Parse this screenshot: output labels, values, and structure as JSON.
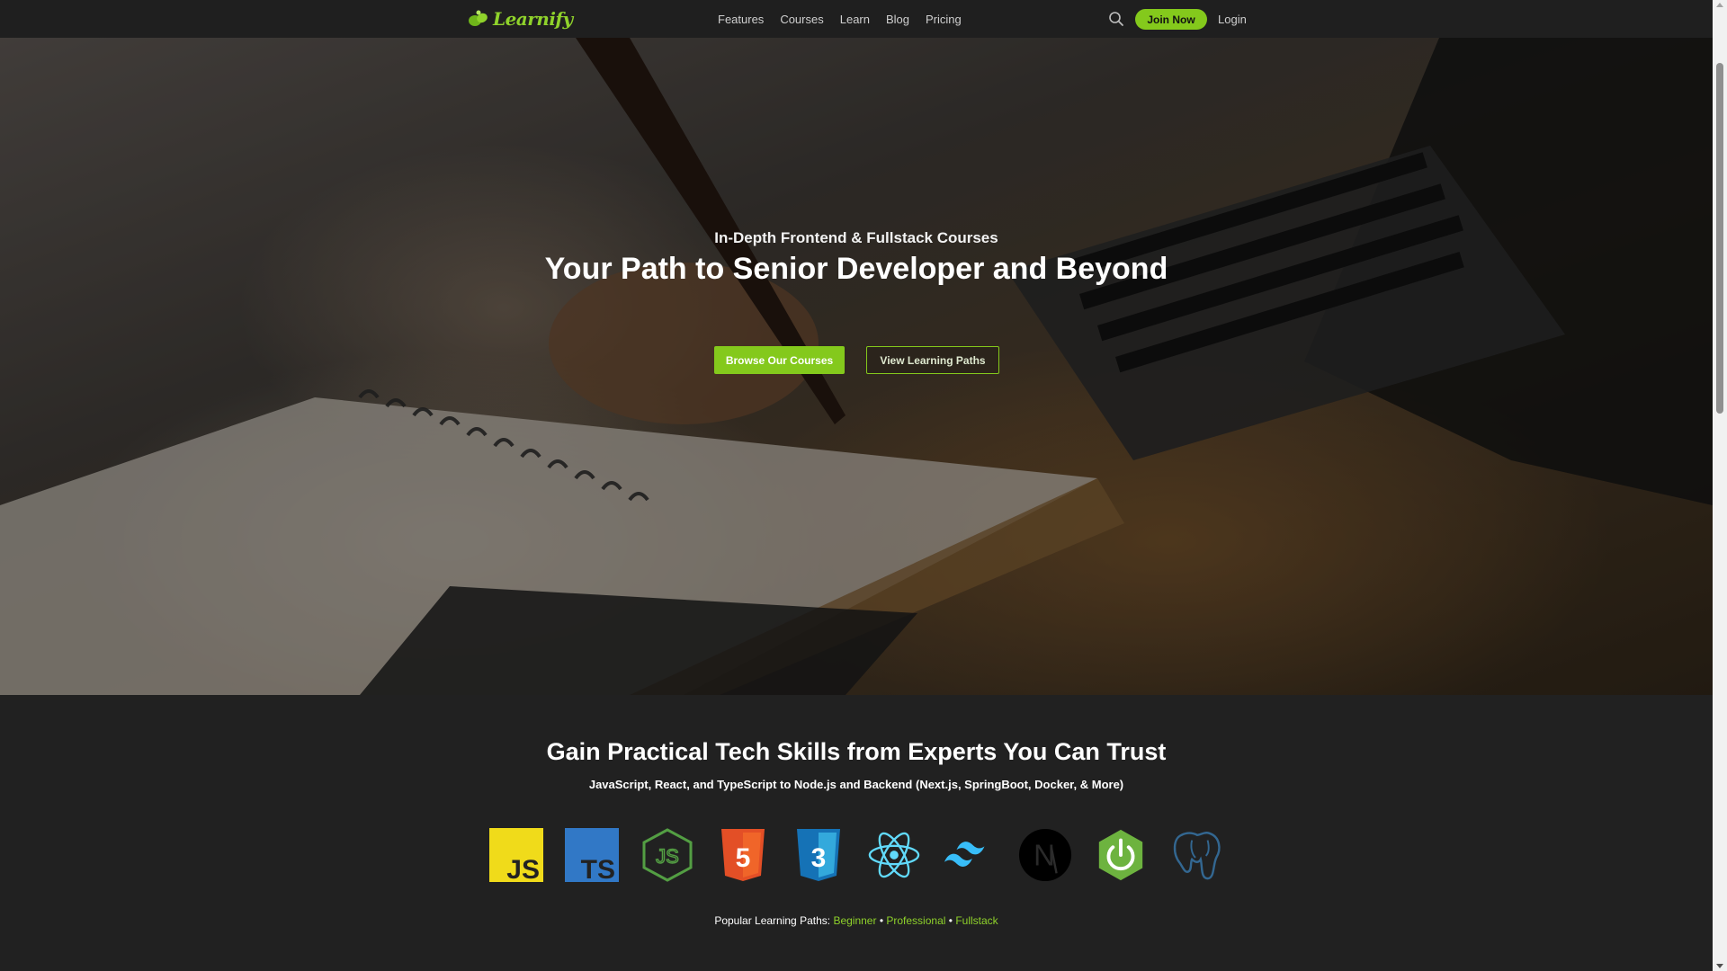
{
  "brand": {
    "name": "Learnify",
    "accent": "#84c91c"
  },
  "nav": {
    "items": [
      {
        "label": "Features"
      },
      {
        "label": "Courses"
      },
      {
        "label": "Learn"
      },
      {
        "label": "Blog"
      },
      {
        "label": "Pricing"
      }
    ],
    "search_icon": "search-icon",
    "join_label": "Join Now",
    "login_label": "Login"
  },
  "hero": {
    "subtitle": "In-Depth Frontend & Fullstack Courses",
    "title": "Your Path to Senior Developer and Beyond",
    "primary_button": "Browse Our Courses",
    "secondary_button": "View Learning Paths"
  },
  "skills": {
    "title": "Gain Practical Tech Skills from Experts You Can Trust",
    "subtitle": "JavaScript, React, and TypeScript to Node.js and Backend (Next.js, SpringBoot, Docker, & More)",
    "technologies": [
      {
        "icon": "javascript-icon",
        "text": "JS"
      },
      {
        "icon": "typescript-icon",
        "text": "TS"
      },
      {
        "icon": "nodejs-icon",
        "text": "JS"
      },
      {
        "icon": "html5-icon",
        "text": "5"
      },
      {
        "icon": "css3-icon",
        "text": "3"
      },
      {
        "icon": "react-icon"
      },
      {
        "icon": "tailwind-icon"
      },
      {
        "icon": "nextjs-icon",
        "text": "N"
      },
      {
        "icon": "spring-boot-icon"
      },
      {
        "icon": "postgresql-icon"
      }
    ],
    "paths_label": "Popular Learning Paths:",
    "paths": [
      "Beginner",
      "Professional",
      "Fullstack"
    ],
    "separator": "•"
  }
}
